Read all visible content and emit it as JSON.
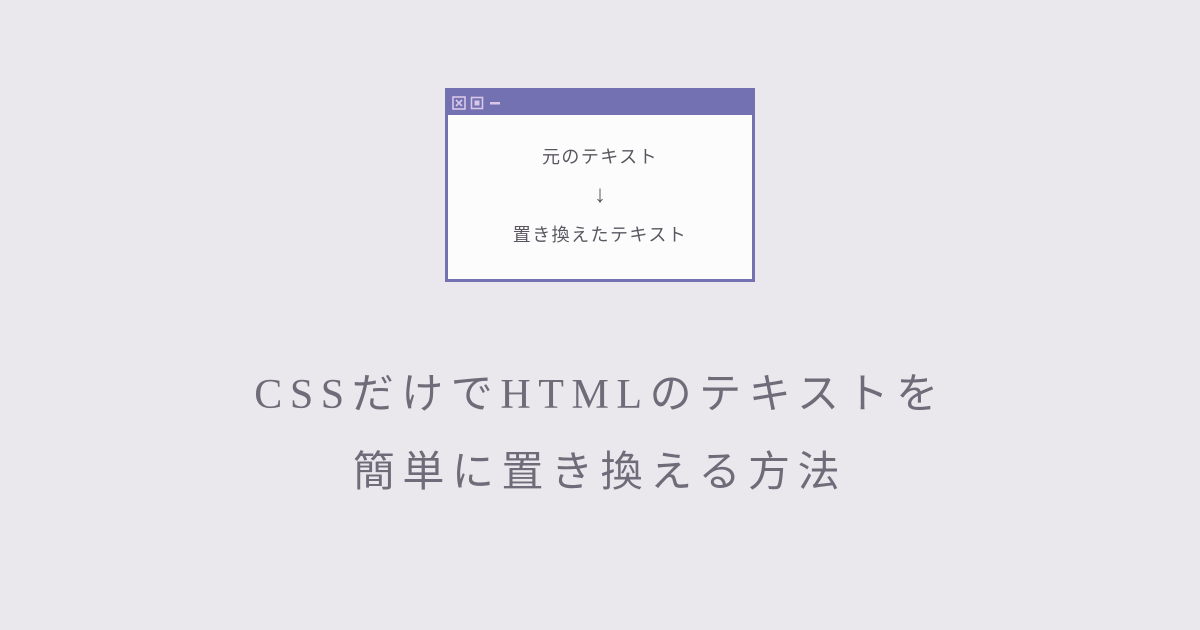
{
  "window": {
    "original_text": "元のテキスト",
    "replaced_text": "置き換えたテキスト"
  },
  "headline": {
    "line1": "CSSだけでHTMLのテキストを",
    "line2": "簡単に置き換える方法"
  },
  "colors": {
    "background": "#eae8ed",
    "window_border": "#7471b3",
    "titlebar": "#7471b3",
    "icon": "#d9c7e6",
    "body_text": "#5a5660",
    "headline_text": "#6f6b79"
  }
}
